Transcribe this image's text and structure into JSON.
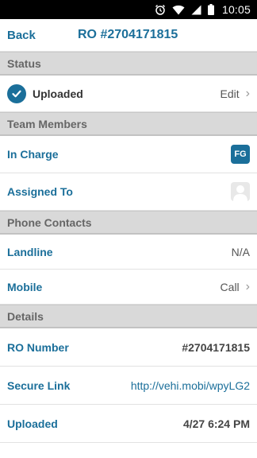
{
  "status_bar": {
    "time": "10:05"
  },
  "nav": {
    "back_label": "Back",
    "title": "RO #2704171815"
  },
  "sections": {
    "status": "Status",
    "team": "Team Members",
    "phone": "Phone Contacts",
    "details": "Details"
  },
  "status_row": {
    "status": "Uploaded",
    "action": "Edit"
  },
  "team": {
    "in_charge_label": "In Charge",
    "in_charge_initials": "FG",
    "assigned_label": "Assigned To"
  },
  "phone": {
    "landline_label": "Landline",
    "landline_value": "N/A",
    "mobile_label": "Mobile",
    "mobile_action": "Call"
  },
  "details": {
    "ro_label": "RO Number",
    "ro_value": "#2704171815",
    "link_label": "Secure Link",
    "link_value": "http://vehi.mobi/wpyLG2",
    "uploaded_label": "Uploaded",
    "uploaded_value": "4/27 6:24 PM"
  },
  "colors": {
    "accent": "#1b6f9a",
    "section_bg": "#d9d9d9"
  }
}
